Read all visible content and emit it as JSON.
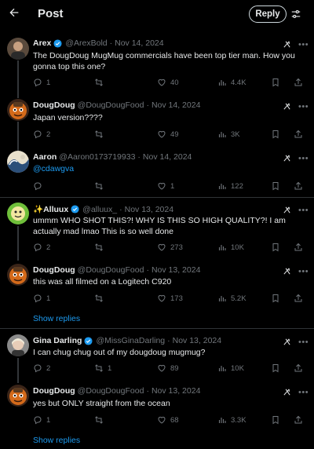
{
  "header": {
    "title": "Post",
    "reply_label": "Reply"
  },
  "tweets": [
    {
      "name": "Arex",
      "handle": "@ArexBold",
      "date": "Nov 14, 2024",
      "text": "The DougDoug MugMug commercials have been top tier man. How you gonna top this one?",
      "replies": "1",
      "retweets": "",
      "likes": "40",
      "views": "4.4K",
      "avatar": "arex-avatar"
    },
    {
      "name": "DougDoug",
      "handle": "@DougDougFood",
      "date": "Nov 14, 2024",
      "text": "Japan version????",
      "replies": "2",
      "retweets": "",
      "likes": "49",
      "views": "3K",
      "avatar": "dougdoug-avatar"
    },
    {
      "name": "Aaron",
      "handle": "@Aaron0173719933",
      "date": "Nov 14, 2024",
      "text": "@cdawgva",
      "replies": "",
      "retweets": "",
      "likes": "1",
      "views": "122",
      "avatar": "aaron-avatar"
    },
    {
      "name": "✨Alluux",
      "handle": "@alluux_",
      "date": "Nov 13, 2024",
      "text": "ummm WHO SHOT THIS?! WHY IS THIS SO HIGH QUALITY?! I am actually mad lmao This is so well done",
      "replies": "2",
      "retweets": "",
      "likes": "273",
      "views": "10K",
      "avatar": "alluux-avatar"
    },
    {
      "name": "DougDoug",
      "handle": "@DougDougFood",
      "date": "Nov 13, 2024",
      "text": "this was all filmed on a Logitech C920",
      "replies": "1",
      "retweets": "",
      "likes": "173",
      "views": "5.2K",
      "avatar": "dougdoug-avatar"
    },
    {
      "name": "Gina Darling",
      "handle": "@MissGinaDarling",
      "date": "Nov 13, 2024",
      "text": "I can chug chug out of my dougdoug mugmug?",
      "replies": "2",
      "retweets": "1",
      "likes": "89",
      "views": "10K",
      "avatar": "gina-avatar"
    },
    {
      "name": "DougDoug",
      "handle": "@DougDougFood",
      "date": "Nov 13, 2024",
      "text": "yes but ONLY straight from the ocean",
      "replies": "1",
      "retweets": "",
      "likes": "68",
      "views": "3.3K",
      "avatar": "dougdoug-avatar"
    }
  ],
  "show_replies_label": "Show replies",
  "colors": {
    "background": "#000000",
    "text": "#e7e9ea",
    "muted": "#71767b",
    "accent": "#1d9bf0",
    "divider": "#2f3336"
  }
}
